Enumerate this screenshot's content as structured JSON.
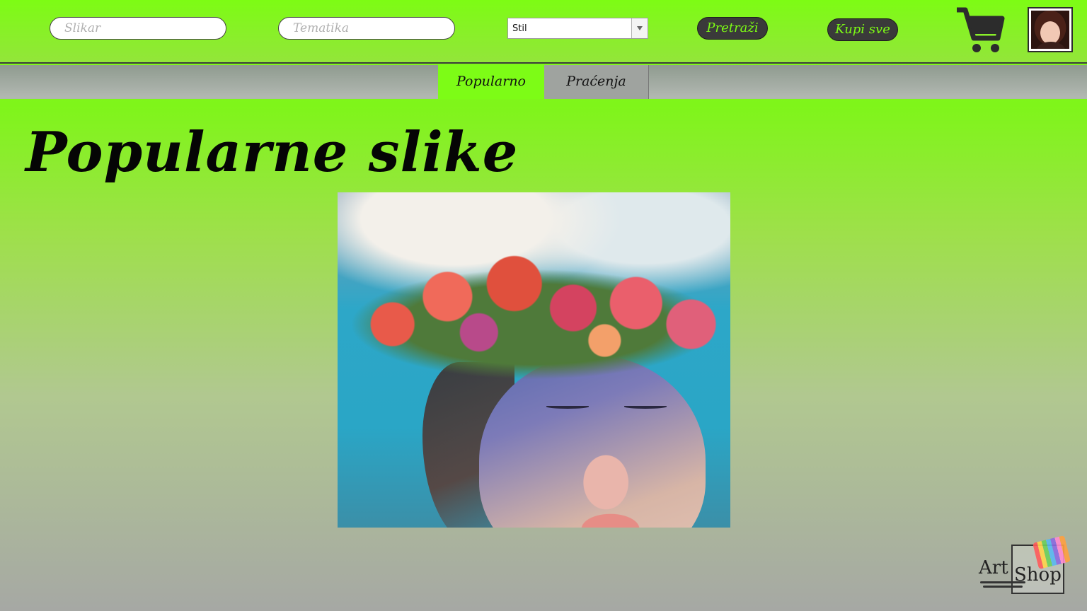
{
  "header": {
    "artist_placeholder": "Slikar",
    "theme_placeholder": "Tematika",
    "style_select_value": "Stil",
    "search_button_label": "Pretraži",
    "buy_all_button_label": "Kupi sve",
    "cart_icon": "cart-icon",
    "avatar_icon": "user-avatar"
  },
  "tabs": [
    {
      "label": "Popularno",
      "active": true
    },
    {
      "label": "Praćenja",
      "active": false
    }
  ],
  "main": {
    "title": "Popularne slike"
  },
  "logo": {
    "word1": "Art",
    "word2": "Shop"
  },
  "colors": {
    "accent_green": "#7dfc16",
    "button_dark": "#3a3a3a",
    "tab_inactive": "#9fa39f"
  }
}
